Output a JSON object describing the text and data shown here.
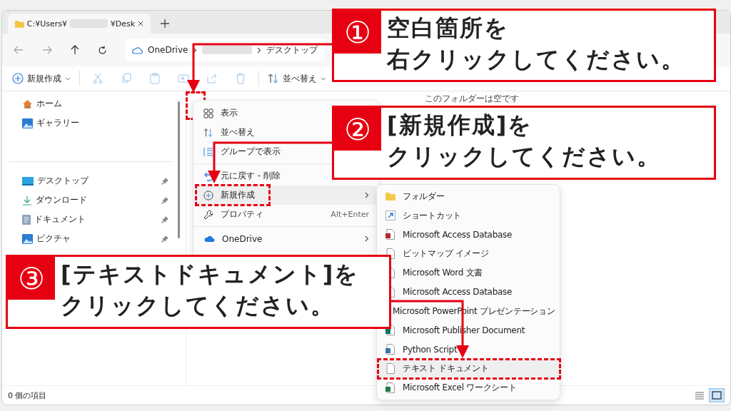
{
  "window": {
    "tab": {
      "title_start": "C:¥Users¥",
      "title_end": "¥Desk"
    },
    "address": {
      "root": "OneDrive",
      "folder": "デスクトップ"
    },
    "toolbar": [
      {
        "kind": "new",
        "label": "新規作成",
        "disabled": false
      },
      {
        "kind": "cut",
        "disabled": true
      },
      {
        "kind": "copy",
        "disabled": true
      },
      {
        "kind": "paste",
        "disabled": true
      },
      {
        "kind": "rename",
        "disabled": true
      },
      {
        "kind": "share",
        "disabled": true
      },
      {
        "kind": "delete",
        "disabled": true
      },
      {
        "kind": "sort",
        "label": "並べ替え",
        "disabled": false
      }
    ],
    "sidebar": {
      "items": [
        {
          "kind": "home",
          "label": "ホーム",
          "pinned": false
        },
        {
          "kind": "gallery",
          "label": "ギャラリー",
          "pinned": false
        },
        {
          "kind": "divider"
        },
        {
          "kind": "desktop",
          "label": "デスクトップ",
          "pinned": true
        },
        {
          "kind": "download",
          "label": "ダウンロード",
          "pinned": true
        },
        {
          "kind": "document",
          "label": "ドキュメント",
          "pinned": true
        },
        {
          "kind": "picture",
          "label": "ピクチャ",
          "pinned": true
        }
      ]
    },
    "empty_message": "このフォルダーは空です",
    "status_bar": {
      "count": "0 個の項目"
    }
  },
  "context_menu": {
    "items": [
      {
        "kind": "view",
        "label": "表示",
        "submenu": false,
        "selected": false,
        "annotated": false
      },
      {
        "kind": "sort",
        "label": "並べ替え",
        "submenu": false,
        "selected": false,
        "annotated": false
      },
      {
        "kind": "group",
        "label": "グループで表示",
        "submenu": false,
        "selected": false,
        "annotated": false
      },
      {
        "kind": "divider"
      },
      {
        "kind": "undo",
        "label": "元に戻す - 削除",
        "submenu": false,
        "selected": false,
        "annotated": false
      },
      {
        "kind": "new",
        "label": "新規作成",
        "submenu": true,
        "selected": true,
        "annotated": true
      },
      {
        "kind": "properties",
        "label": "プロパティ",
        "shortcut": "Alt+Enter",
        "submenu": false,
        "selected": false,
        "annotated": false
      },
      {
        "kind": "divider"
      },
      {
        "kind": "onedrive",
        "label": "OneDrive",
        "submenu": true,
        "selected": false,
        "annotated": false
      }
    ]
  },
  "submenu": {
    "items": [
      {
        "kind": "folder",
        "label": "フォルダー",
        "selected": false,
        "annotated": false
      },
      {
        "kind": "shortcut",
        "label": "ショートカット",
        "selected": false,
        "annotated": false
      },
      {
        "kind": "access",
        "label": "Microsoft Access Database",
        "selected": false,
        "annotated": false
      },
      {
        "kind": "bitmap",
        "label": "ビットマップ イメージ",
        "selected": false,
        "annotated": false
      },
      {
        "kind": "word",
        "label": "Microsoft Word 文書",
        "selected": false,
        "annotated": false
      },
      {
        "kind": "access",
        "label": "Microsoft Access Database",
        "selected": false,
        "annotated": false
      },
      {
        "kind": "powerpoint",
        "label": "Microsoft PowerPoint プレゼンテーション",
        "selected": false,
        "annotated": false
      },
      {
        "kind": "publisher",
        "label": "Microsoft Publisher Document",
        "selected": false,
        "annotated": false
      },
      {
        "kind": "python",
        "label": "Python Script",
        "selected": false,
        "annotated": false
      },
      {
        "kind": "text",
        "label": "テキスト ドキュメント",
        "selected": true,
        "annotated": true
      },
      {
        "kind": "excel",
        "label": "Microsoft Excel ワークシート",
        "selected": false,
        "annotated": false
      }
    ]
  },
  "callouts": [
    {
      "number": "①",
      "lines": [
        "空白箇所を",
        "右クリックしてください。"
      ]
    },
    {
      "number": "②",
      "lines": [
        "[新規作成]を",
        "クリックしてください。"
      ]
    },
    {
      "number": "③",
      "lines": [
        "[テキストドキュメント]を",
        "クリックしてください。"
      ]
    }
  ]
}
